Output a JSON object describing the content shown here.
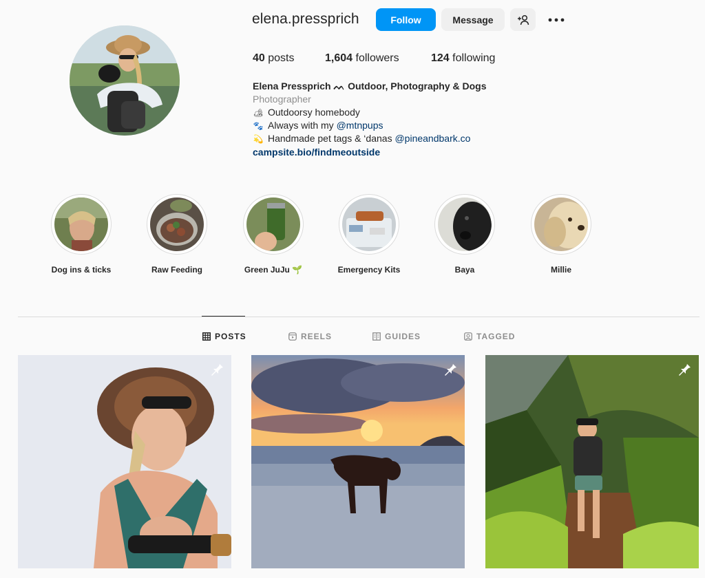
{
  "profile": {
    "username": "elena.pressprich",
    "follow_label": "Follow",
    "message_label": "Message",
    "posts_count": "40",
    "posts_label": "posts",
    "followers_count": "1,604",
    "followers_label": "followers",
    "following_count": "124",
    "following_label": "following"
  },
  "bio": {
    "name": "Elena Pressprich ᨓ Outdoor, Photography & Dogs",
    "category": "Photographer",
    "line1": "Outdoorsy homebody",
    "line2_text": "Always with my ",
    "line2_mention": "@mtnpups",
    "line3_text": "Handmade pet tags & ‘danas ",
    "line3_mention": "@pineandbark.co",
    "link": "campsite.bio/findmeoutside"
  },
  "highlights": [
    {
      "label": "Dog ins & ticks"
    },
    {
      "label": "Raw Feeding"
    },
    {
      "label": "Green JuJu 🌱"
    },
    {
      "label": "Emergency Kits"
    },
    {
      "label": "Baya"
    },
    {
      "label": "Millie"
    }
  ],
  "tabs": [
    {
      "label": "POSTS",
      "icon": "grid-icon"
    },
    {
      "label": "REELS",
      "icon": "reels-icon"
    },
    {
      "label": "GUIDES",
      "icon": "guides-icon"
    },
    {
      "label": "TAGGED",
      "icon": "tagged-icon"
    }
  ],
  "colors": {
    "accent": "#0095f6",
    "link": "#00376b",
    "background": "#fafafa"
  }
}
